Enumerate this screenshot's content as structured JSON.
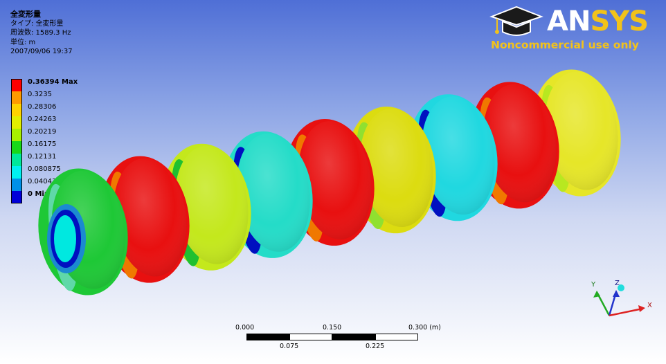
{
  "info": {
    "title": "全変形量",
    "type_line": "タイプ: 全変形量",
    "frequency_line": "周波数: 1589.3 Hz",
    "unit_line": "単位: m",
    "date_line": "2007/09/06 19:37"
  },
  "legend": [
    {
      "label": "0.36394 Max",
      "color": "#ff0000",
      "bold": true
    },
    {
      "label": "0.3235",
      "color": "#ff9a00",
      "bold": false
    },
    {
      "label": "0.28306",
      "color": "#ffd200",
      "bold": false
    },
    {
      "label": "0.24263",
      "color": "#e2ef00",
      "bold": false
    },
    {
      "label": "0.20219",
      "color": "#a8f000",
      "bold": false
    },
    {
      "label": "0.16175",
      "color": "#18d818",
      "bold": false
    },
    {
      "label": "0.12131",
      "color": "#00e89a",
      "bold": false
    },
    {
      "label": "0.080875",
      "color": "#00f0f0",
      "bold": false
    },
    {
      "label": "0.040438",
      "color": "#0090e8",
      "bold": false
    },
    {
      "label": "0 Min",
      "color": "#0000d8",
      "bold": true
    }
  ],
  "logo": {
    "brand_part1": "AN",
    "brand_part2": "SYS",
    "subtitle": "Noncommercial use only"
  },
  "scale_bar": {
    "top_labels": [
      "0.000",
      "0.150",
      "0.300 (m)"
    ],
    "bottom_labels": [
      "0.075",
      "0.225"
    ]
  },
  "triad": {
    "x_label": "X",
    "y_label": "Y",
    "z_label": "Z"
  },
  "model": {
    "rings": [
      {
        "main": "#1ec836",
        "inner": "#5fd8a8"
      },
      {
        "main": "#e81010",
        "inner": "#f07800"
      },
      {
        "main": "#c4e81c",
        "inner": "#20c030"
      },
      {
        "main": "#24dcc8",
        "inner": "#0010c0"
      },
      {
        "main": "#e81010",
        "inner": "#f07800"
      },
      {
        "main": "#dcdc10",
        "inner": "#90e030"
      },
      {
        "main": "#20d8e0",
        "inner": "#0010c0"
      },
      {
        "main": "#e81010",
        "inner": "#f07800"
      },
      {
        "main": "#e6e628",
        "inner": "#b8e820"
      }
    ]
  }
}
